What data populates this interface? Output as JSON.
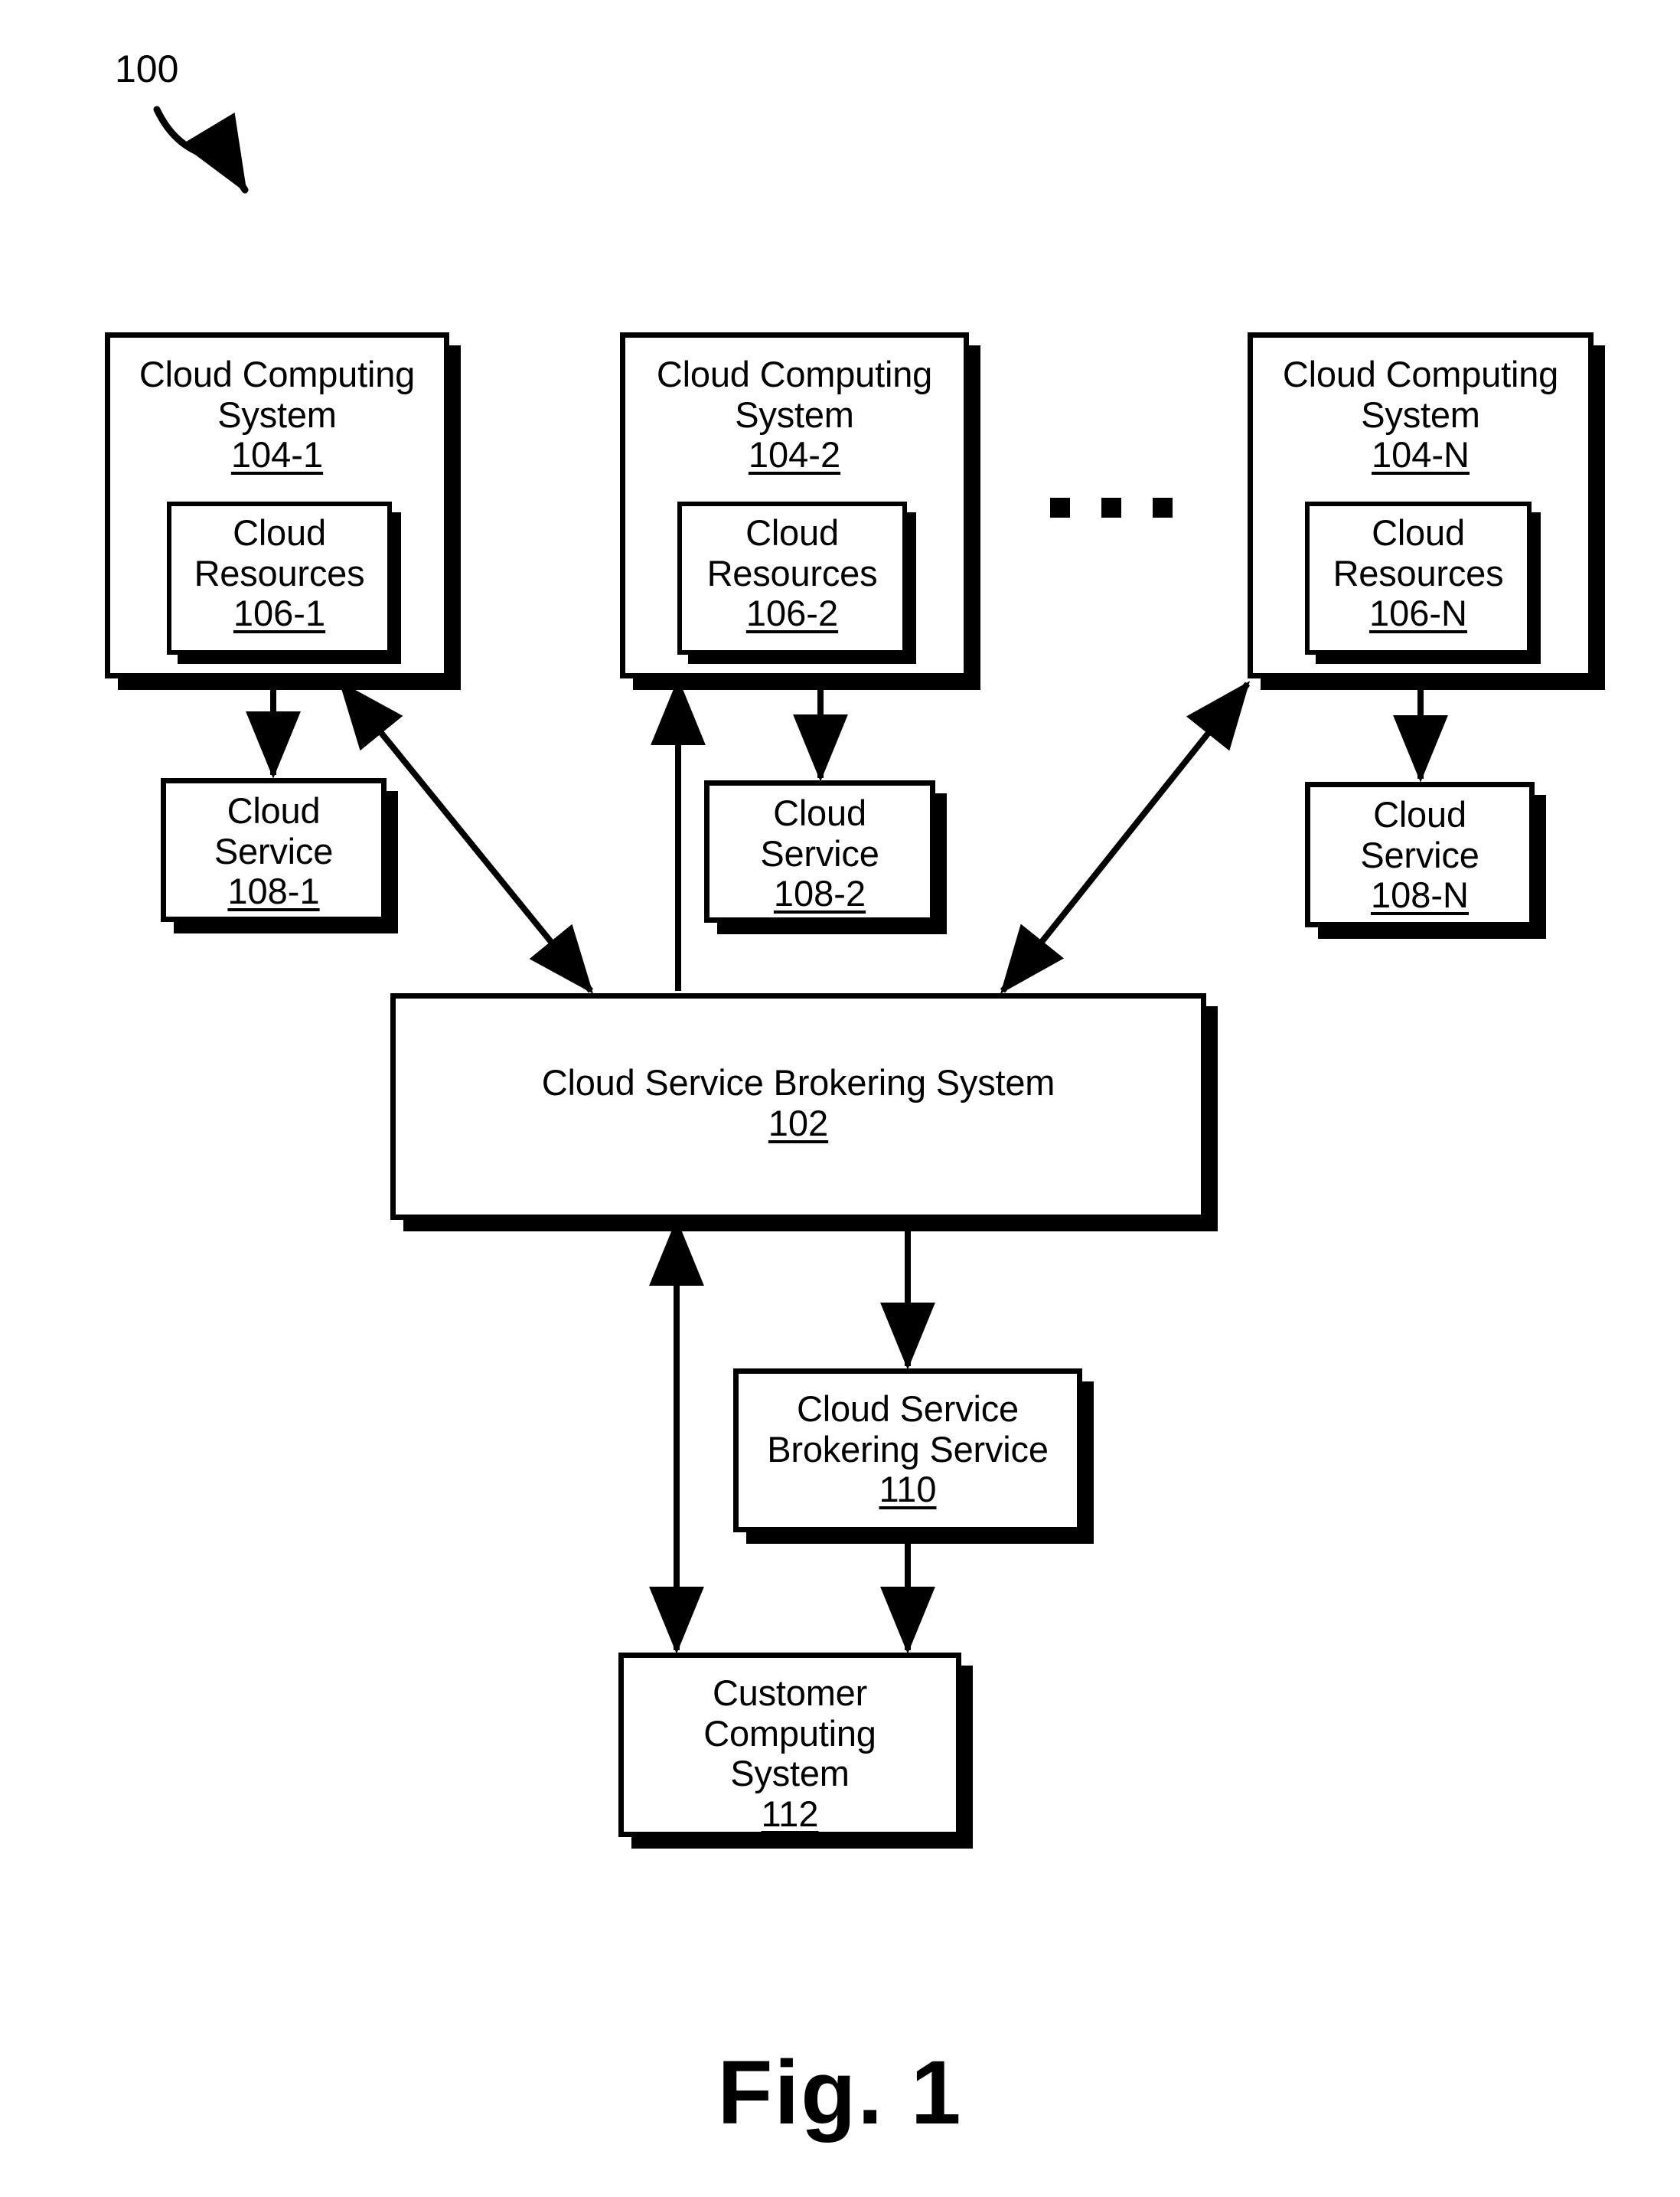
{
  "figure": {
    "label": "100",
    "caption": "Fig. 1",
    "ellipsis": "· · ·"
  },
  "nodes": {
    "cloud_computing_system_1": {
      "title": "Cloud Computing\nSystem",
      "ref": "104-1"
    },
    "cloud_computing_system_2": {
      "title": "Cloud Computing\nSystem",
      "ref": "104-2"
    },
    "cloud_computing_system_n": {
      "title": "Cloud Computing\nSystem",
      "ref": "104-N"
    },
    "cloud_resources_1": {
      "title": "Cloud\nResources",
      "ref": "106-1"
    },
    "cloud_resources_2": {
      "title": "Cloud\nResources",
      "ref": "106-2"
    },
    "cloud_resources_n": {
      "title": "Cloud\nResources",
      "ref": "106-N"
    },
    "cloud_service_1": {
      "title": "Cloud\nService",
      "ref": "108-1"
    },
    "cloud_service_2": {
      "title": "Cloud\nService",
      "ref": "108-2"
    },
    "cloud_service_n": {
      "title": "Cloud\nService",
      "ref": "108-N"
    },
    "cloud_service_brokering_system": {
      "title": "Cloud Service Brokering System",
      "ref": "102"
    },
    "cloud_service_brokering_service": {
      "title": "Cloud Service\nBrokering Service",
      "ref": "110"
    },
    "customer_computing_system": {
      "title": "Customer\nComputing\nSystem",
      "ref": "112"
    }
  }
}
